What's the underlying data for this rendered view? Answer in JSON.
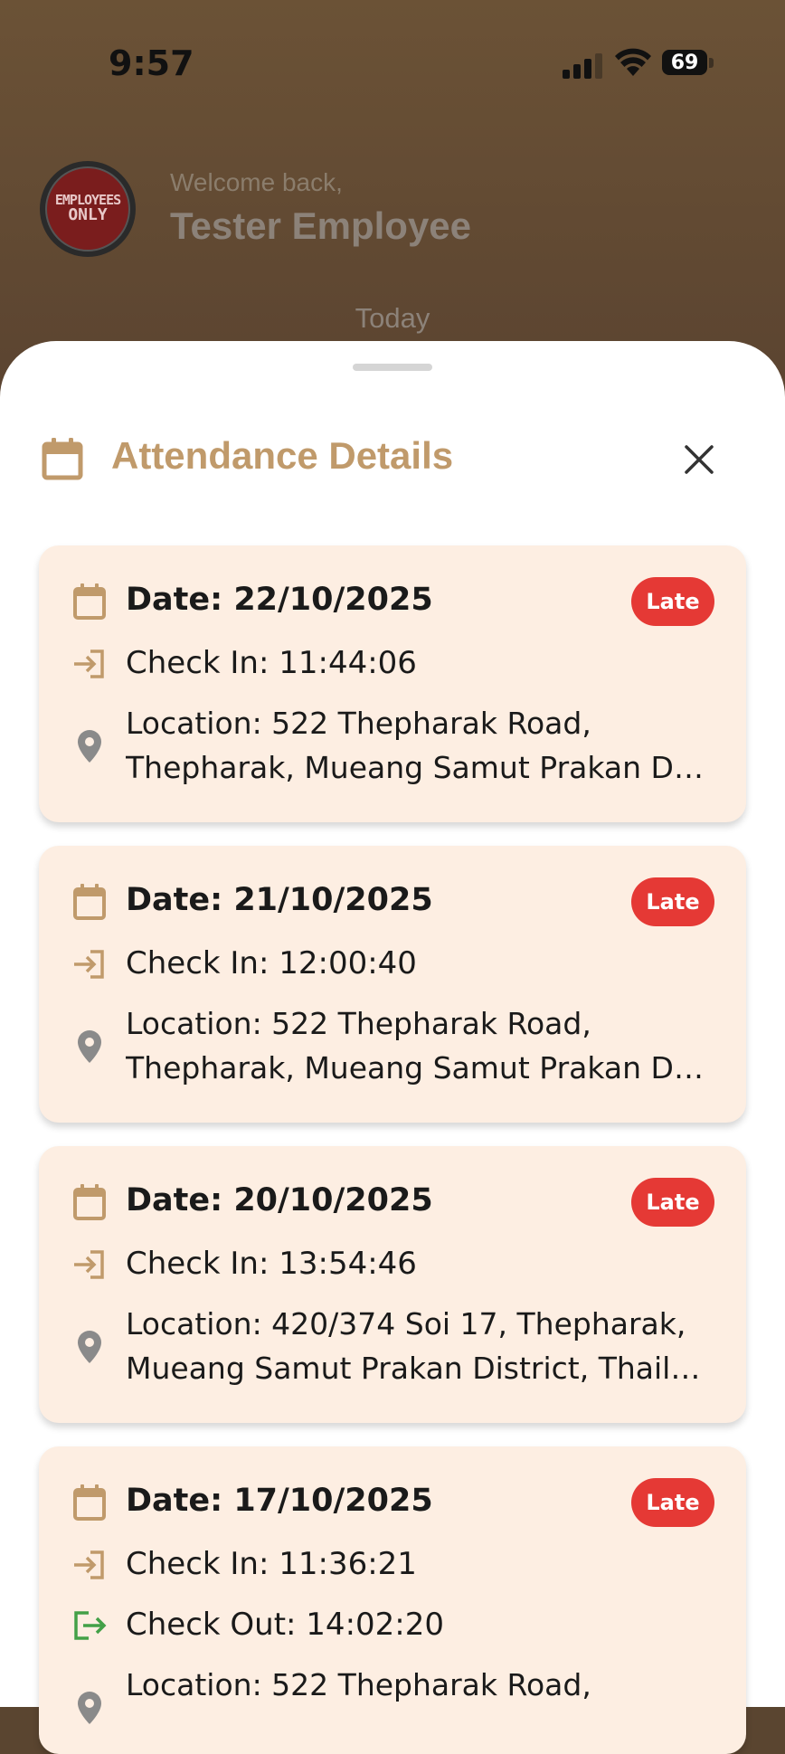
{
  "status_bar": {
    "time": "9:57",
    "battery": "69"
  },
  "header": {
    "avatar_text_line1": "EMPLOYEES",
    "avatar_text_line2": "ONLY",
    "welcome": "Welcome back,",
    "name": "Tester Employee",
    "section": "Today"
  },
  "sheet": {
    "title": "Attendance Details",
    "records": [
      {
        "date": "Date: 22/10/2025",
        "status": "Late",
        "check_in": "Check In: 11:44:06",
        "location_line1": "Location: 522 Thepharak Road,",
        "location_line2": "Thepharak, Mueang Samut Prakan Di…"
      },
      {
        "date": "Date: 21/10/2025",
        "status": "Late",
        "check_in": "Check In: 12:00:40",
        "location_line1": "Location: 522 Thepharak Road,",
        "location_line2": "Thepharak, Mueang Samut Prakan Di…"
      },
      {
        "date": "Date: 20/10/2025",
        "status": "Late",
        "check_in": "Check In: 13:54:46",
        "location_line1": "Location: 420/374 Soi 17, Thepharak,",
        "location_line2": "Mueang Samut Prakan District, Thail…"
      },
      {
        "date": "Date: 17/10/2025",
        "status": "Late",
        "check_in": "Check In: 11:36:21",
        "check_out": "Check Out: 14:02:20",
        "location_line1": "Location: 522 Thepharak Road,",
        "location_line2": ""
      }
    ]
  },
  "colors": {
    "accent": "#c09a6b",
    "badge_late": "#e53935",
    "card_bg": "#fdeee2",
    "checkout_icon": "#43a047"
  }
}
